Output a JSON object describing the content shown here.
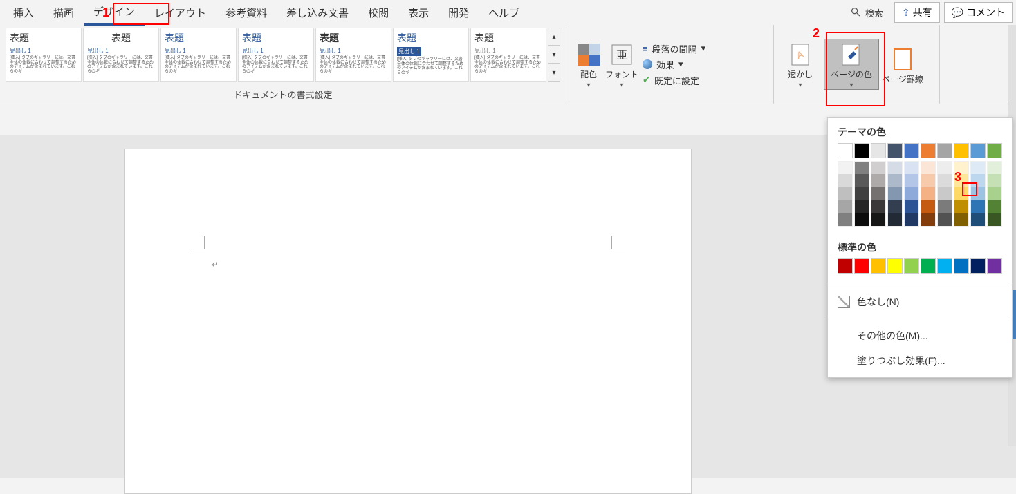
{
  "tabs": {
    "insert": "挿入",
    "draw": "描画",
    "design": "デザイン",
    "layout": "レイアウト",
    "references": "参考資料",
    "mailings": "差し込み文書",
    "review": "校閲",
    "view": "表示",
    "developer": "開発",
    "help": "ヘルプ",
    "search": "検索",
    "share": "共有",
    "comments": "コメント"
  },
  "ribbon": {
    "doc_format_label": "ドキュメントの書式設定",
    "colors": "配色",
    "fonts": "フォント",
    "paragraph_spacing": "段落の間隔",
    "effects": "効果",
    "set_default": "既定に設定",
    "watermark": "透かし",
    "page_color": "ページの色",
    "page_borders": "ページ罫線"
  },
  "style_card": {
    "title": "表題",
    "heading": "見出し 1",
    "body": "[挿入] タブのギャラリーには、文書全体の体裁に合わせて調整するためのアイテムが含まれています。これらのギ"
  },
  "color_dropdown": {
    "theme_colors": "テーマの色",
    "standard_colors": "標準の色",
    "no_color": "色なし(N)",
    "more_colors": "その他の色(M)...",
    "fill_effects": "塗りつぶし効果(F)..."
  },
  "annotations": {
    "a1": "1",
    "a2": "2",
    "a3": "3"
  },
  "theme_row1": [
    "#ffffff",
    "#000000",
    "#e7e6e6",
    "#44546a",
    "#4472c4",
    "#ed7d31",
    "#a5a5a5",
    "#ffc000",
    "#5b9bd5",
    "#70ad47"
  ],
  "theme_shade_cols": [
    [
      "#f2f2f2",
      "#d9d9d9",
      "#bfbfbf",
      "#a6a6a6",
      "#808080"
    ],
    [
      "#808080",
      "#595959",
      "#404040",
      "#262626",
      "#0d0d0d"
    ],
    [
      "#d0cece",
      "#aeaaaa",
      "#757171",
      "#3a3838",
      "#161616"
    ],
    [
      "#d6dce5",
      "#acb9ca",
      "#8497b0",
      "#333f50",
      "#222a35"
    ],
    [
      "#d9e2f3",
      "#b4c6e7",
      "#8eaadb",
      "#2f5496",
      "#1f3864"
    ],
    [
      "#fbe5d6",
      "#f7caac",
      "#f4b183",
      "#c55a11",
      "#833c0c"
    ],
    [
      "#ededed",
      "#dbdbdb",
      "#c9c9c9",
      "#7b7b7b",
      "#525252"
    ],
    [
      "#fff2cc",
      "#ffe699",
      "#ffd966",
      "#bf8f00",
      "#806000"
    ],
    [
      "#deebf7",
      "#bdd7ee",
      "#9dc3e2",
      "#2e75b6",
      "#1f4e79"
    ],
    [
      "#e2efda",
      "#c5e0b4",
      "#a9d18e",
      "#548235",
      "#385723"
    ]
  ],
  "standard_colors": [
    "#c00000",
    "#ff0000",
    "#ffc000",
    "#ffff00",
    "#92d050",
    "#00b050",
    "#00b0f0",
    "#0070c0",
    "#002060",
    "#7030a0"
  ]
}
